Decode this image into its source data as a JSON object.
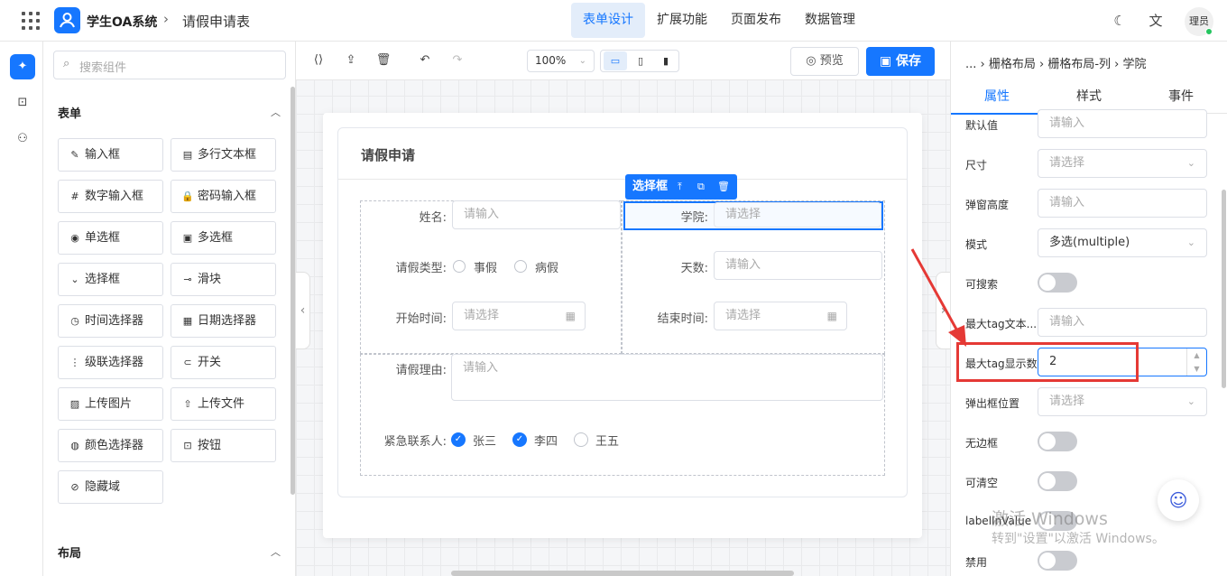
{
  "header": {
    "app_name": "学生OA系统",
    "crumb_sep": "›",
    "page_title": "请假申请表",
    "nav": [
      "表单设计",
      "扩展功能",
      "页面发布",
      "数据管理"
    ],
    "nav_active": 0,
    "avatar_text": "理员",
    "icons": {
      "menu": "grid-icon",
      "theme": "moon-icon",
      "lang": "translate-icon"
    }
  },
  "left_panel": {
    "search_placeholder": "搜索组件",
    "section_form": "表单",
    "components": [
      {
        "label": "输入框",
        "icon": "✎"
      },
      {
        "label": "多行文本框",
        "icon": "▤"
      },
      {
        "label": "数字输入框",
        "icon": "#"
      },
      {
        "label": "密码输入框",
        "icon": "🔒"
      },
      {
        "label": "单选框",
        "icon": "◉"
      },
      {
        "label": "多选框",
        "icon": "▣"
      },
      {
        "label": "选择框",
        "icon": "⌄"
      },
      {
        "label": "滑块",
        "icon": "⊸"
      },
      {
        "label": "时间选择器",
        "icon": "◷"
      },
      {
        "label": "日期选择器",
        "icon": "▦"
      },
      {
        "label": "级联选择器",
        "icon": "⋮"
      },
      {
        "label": "开关",
        "icon": "⊂"
      },
      {
        "label": "上传图片",
        "icon": "▨"
      },
      {
        "label": "上传文件",
        "icon": "⇧"
      },
      {
        "label": "颜色选择器",
        "icon": "◍"
      },
      {
        "label": "按钮",
        "icon": "⊡"
      },
      {
        "label": "隐藏域",
        "icon": "⊘"
      }
    ],
    "section_layout": "布局"
  },
  "toolbar": {
    "zoom": "100%",
    "preview_label": "预览",
    "save_label": "保存"
  },
  "form": {
    "title": "请假申请",
    "selected_tag": "选择框",
    "name_label": "姓名:",
    "name_placeholder": "请输入",
    "college_label": "学院:",
    "college_placeholder": "请选择",
    "leave_type_label": "请假类型:",
    "leave_type_options": [
      "事假",
      "病假"
    ],
    "days_label": "天数:",
    "days_placeholder": "请输入",
    "start_label": "开始时间:",
    "start_placeholder": "请选择",
    "end_label": "结束时间:",
    "end_placeholder": "请选择",
    "reason_label": "请假理由:",
    "reason_placeholder": "请输入",
    "contact_label": "紧急联系人:",
    "contacts": [
      {
        "name": "张三",
        "checked": true
      },
      {
        "name": "李四",
        "checked": true
      },
      {
        "name": "王五",
        "checked": false
      }
    ]
  },
  "right_panel": {
    "breadcrumb": "... › 栅格布局 › 栅格布局-列 › 学院",
    "tabs": [
      "属性",
      "样式",
      "事件"
    ],
    "tab_active": 0,
    "props": {
      "default_label": "默认值",
      "default_ph": "请输入",
      "size_label": "尺寸",
      "size_ph": "请选择",
      "popup_height_label": "弹窗高度",
      "popup_height_ph": "请输入",
      "mode_label": "模式",
      "mode_value": "多选(multiple)",
      "searchable_label": "可搜索",
      "max_tag_text_label": "最大tag文本...",
      "max_tag_text_ph": "请输入",
      "max_tag_count_label": "最大tag显示数",
      "max_tag_count_value": "2",
      "popup_pos_label": "弹出框位置",
      "popup_pos_ph": "请选择",
      "borderless_label": "无边框",
      "clearable_label": "可清空",
      "label_in_value_label": "labelInValue",
      "disabled_label": "禁用"
    }
  },
  "overlay": {
    "watermark_line1": "激活 Windows",
    "watermark_line2": "转到\"设置\"以激活 Windows。",
    "highlight_color": "#e53935"
  }
}
